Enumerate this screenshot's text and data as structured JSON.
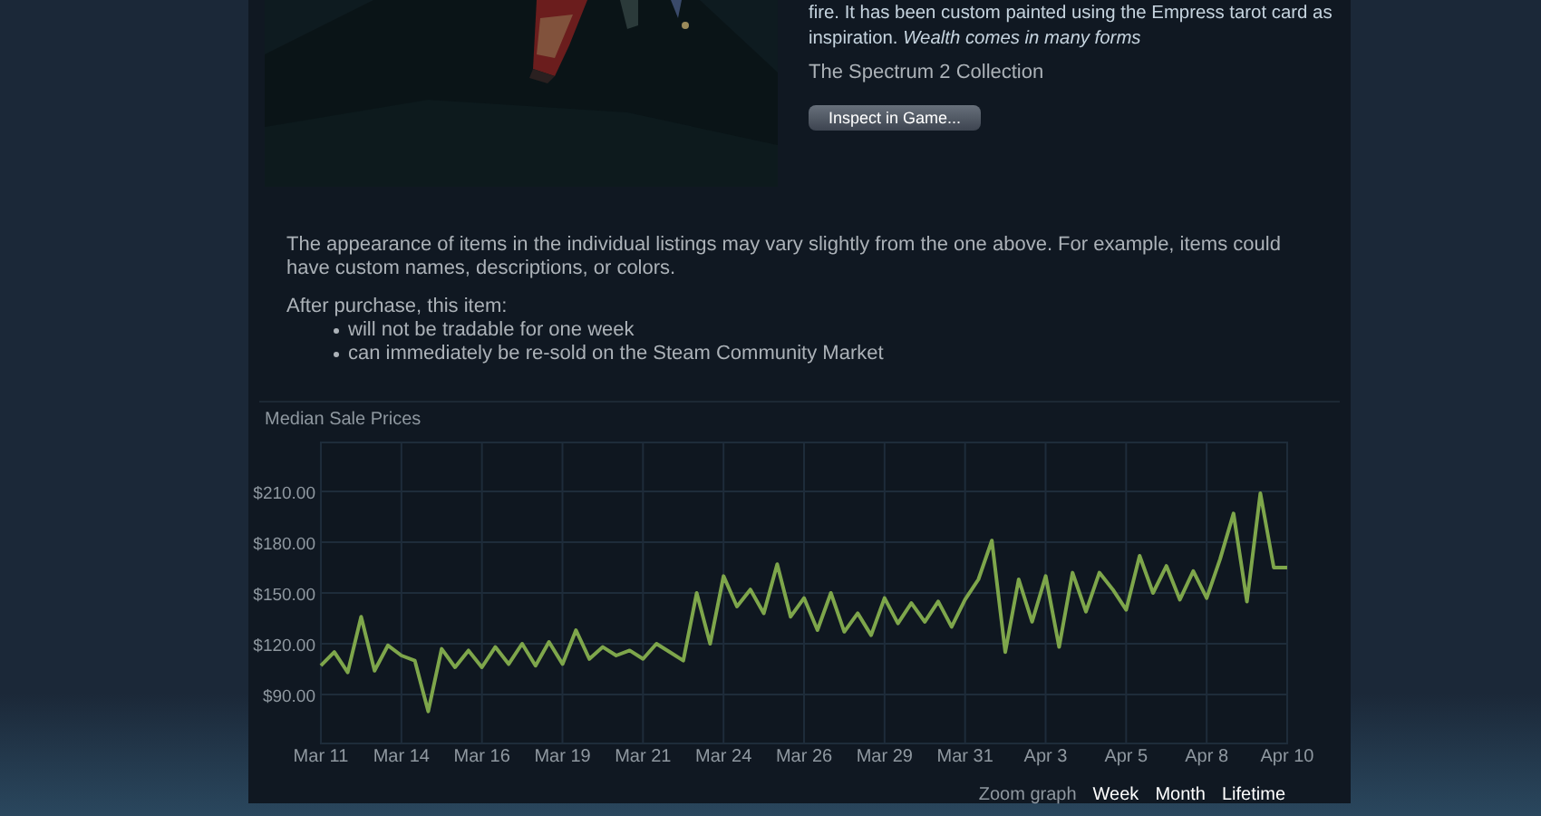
{
  "item": {
    "description_cut": "fire. It has been custom painted using the Empress tarot card as",
    "description_end": "inspiration. *Wealth comes in many forms*",
    "collection": "The Spectrum 2 Collection",
    "inspect_button": "Inspect in Game..."
  },
  "notice": {
    "text": "The appearance of items in the individual listings may vary slightly from the one above. For example, items could have custom names, descriptions, or colors.",
    "after_purchase": "After purchase, this item:",
    "bullets": [
      "will not be tradable for one week",
      "can immediately be re-sold on the Steam Community Market"
    ]
  },
  "price_history": {
    "chart_data": {
      "type": "line",
      "title": "Median Sale Prices",
      "grid": true,
      "ylim": [
        61,
        239
      ],
      "categories": [
        "Mar 11",
        null,
        null,
        null,
        null,
        null,
        "Mar 14",
        null,
        null,
        null,
        null,
        null,
        "Mar 16",
        null,
        null,
        null,
        null,
        null,
        "Mar 19",
        null,
        null,
        null,
        null,
        null,
        "Mar 21",
        null,
        null,
        null,
        null,
        null,
        "Mar 24",
        null,
        null,
        null,
        null,
        null,
        "Mar 26",
        null,
        null,
        null,
        null,
        null,
        "Mar 29",
        null,
        null,
        null,
        null,
        null,
        "Mar 31",
        null,
        null,
        null,
        null,
        null,
        "Apr 3",
        null,
        null,
        null,
        null,
        null,
        "Apr 5",
        null,
        null,
        null,
        null,
        null,
        "Apr 8",
        null,
        null,
        null,
        null,
        null,
        "Apr 10"
      ],
      "yticks": [
        {
          "value": 90,
          "label": "$90.00"
        },
        {
          "value": 120,
          "label": "$120.00"
        },
        {
          "value": 150,
          "label": "$150.00"
        },
        {
          "value": 180,
          "label": "$180.00"
        },
        {
          "value": 210,
          "label": "$210.00"
        }
      ],
      "series": [
        {
          "color": "#7ea64b",
          "values": [
            107,
            115,
            103,
            136,
            104,
            119,
            113,
            110,
            80,
            117,
            106,
            116,
            106,
            118,
            108,
            120,
            107,
            121,
            108,
            128,
            111,
            118,
            113,
            116,
            111,
            120,
            115,
            110,
            150,
            120,
            160,
            142,
            152,
            138,
            167,
            136,
            147,
            128,
            150,
            127,
            138,
            125,
            147,
            132,
            144,
            133,
            145,
            130,
            146,
            158,
            181,
            115,
            158,
            133,
            160,
            118,
            162,
            139,
            162,
            152,
            140,
            172,
            150,
            166,
            146,
            163,
            147,
            170,
            197,
            145,
            209,
            165,
            165
          ]
        }
      ]
    },
    "zoom_label": "Zoom graph",
    "zoom_options": [
      "Week",
      "Month",
      "Lifetime"
    ]
  }
}
